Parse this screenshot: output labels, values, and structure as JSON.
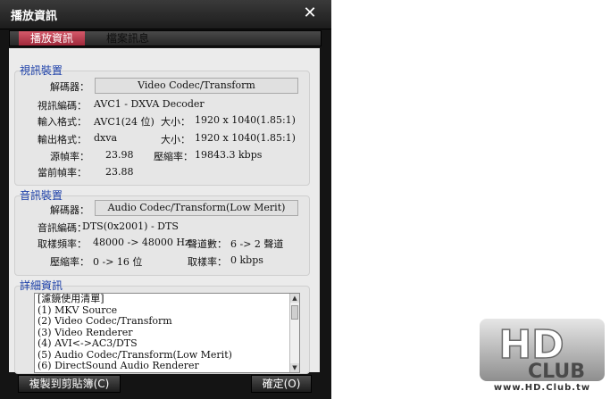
{
  "window": {
    "title": "播放資訊"
  },
  "tabs": [
    {
      "label": "播放資訊"
    },
    {
      "label": "檔案訊息"
    }
  ],
  "video": {
    "section_title": "視訊裝置",
    "decoder_label": "解碼器：",
    "decoder_value": "Video Codec/Transform",
    "codec_label": "視訊編碼：",
    "codec_value": "AVC1 - DXVA Decoder",
    "input_label": "輸入格式：",
    "input_value": "AVC1(24 位)",
    "input_size_label": "大小：",
    "input_size_value": "1920 x 1040(1.85:1)",
    "output_label": "輸出格式：",
    "output_value": "dxva",
    "output_size_label": "大小：",
    "output_size_value": "1920 x 1040(1.85:1)",
    "src_fps_label": "源幀率：",
    "src_fps_value": "23.98",
    "bitrate_label": "壓縮率：",
    "bitrate_value": "19843.3 kbps",
    "cur_fps_label": "當前幀率：",
    "cur_fps_value": "23.88"
  },
  "audio": {
    "section_title": "音訊裝置",
    "decoder_label": "解碼器：",
    "decoder_value": "Audio Codec/Transform(Low Merit)",
    "codec_label": "音訊編碼：",
    "codec_value": "DTS(0x2001) - DTS",
    "sample_label": "取樣頻率：",
    "sample_value": "48000 -> 48000 Hz",
    "channels_label": "聲道數：",
    "channels_value": "6 -> 2 聲道",
    "compress_label": "壓縮率：",
    "compress_value": "0 -> 16 位",
    "sample_rate_label": "取樣率：",
    "sample_rate_value": "0 kbps"
  },
  "details": {
    "section_title": "詳細資訊",
    "lines": [
      "[濾鏡使用清單]",
      "(1) MKV Source",
      "(2) Video Codec/Transform",
      "(3) Video Renderer",
      "(4) AVI<->AC3/DTS",
      "(5) Audio Codec/Transform(Low Merit)",
      "(6) DirectSound Audio Renderer"
    ]
  },
  "buttons": {
    "copy": "複製到剪貼簿(C)",
    "ok": "確定(O)"
  },
  "watermark": {
    "main": "HD",
    "sub": "CLUB",
    "url": "www.HD.Club.tw"
  },
  "colors": {
    "accent_tab": "#c0394b",
    "section_title": "#1a3ea8"
  }
}
